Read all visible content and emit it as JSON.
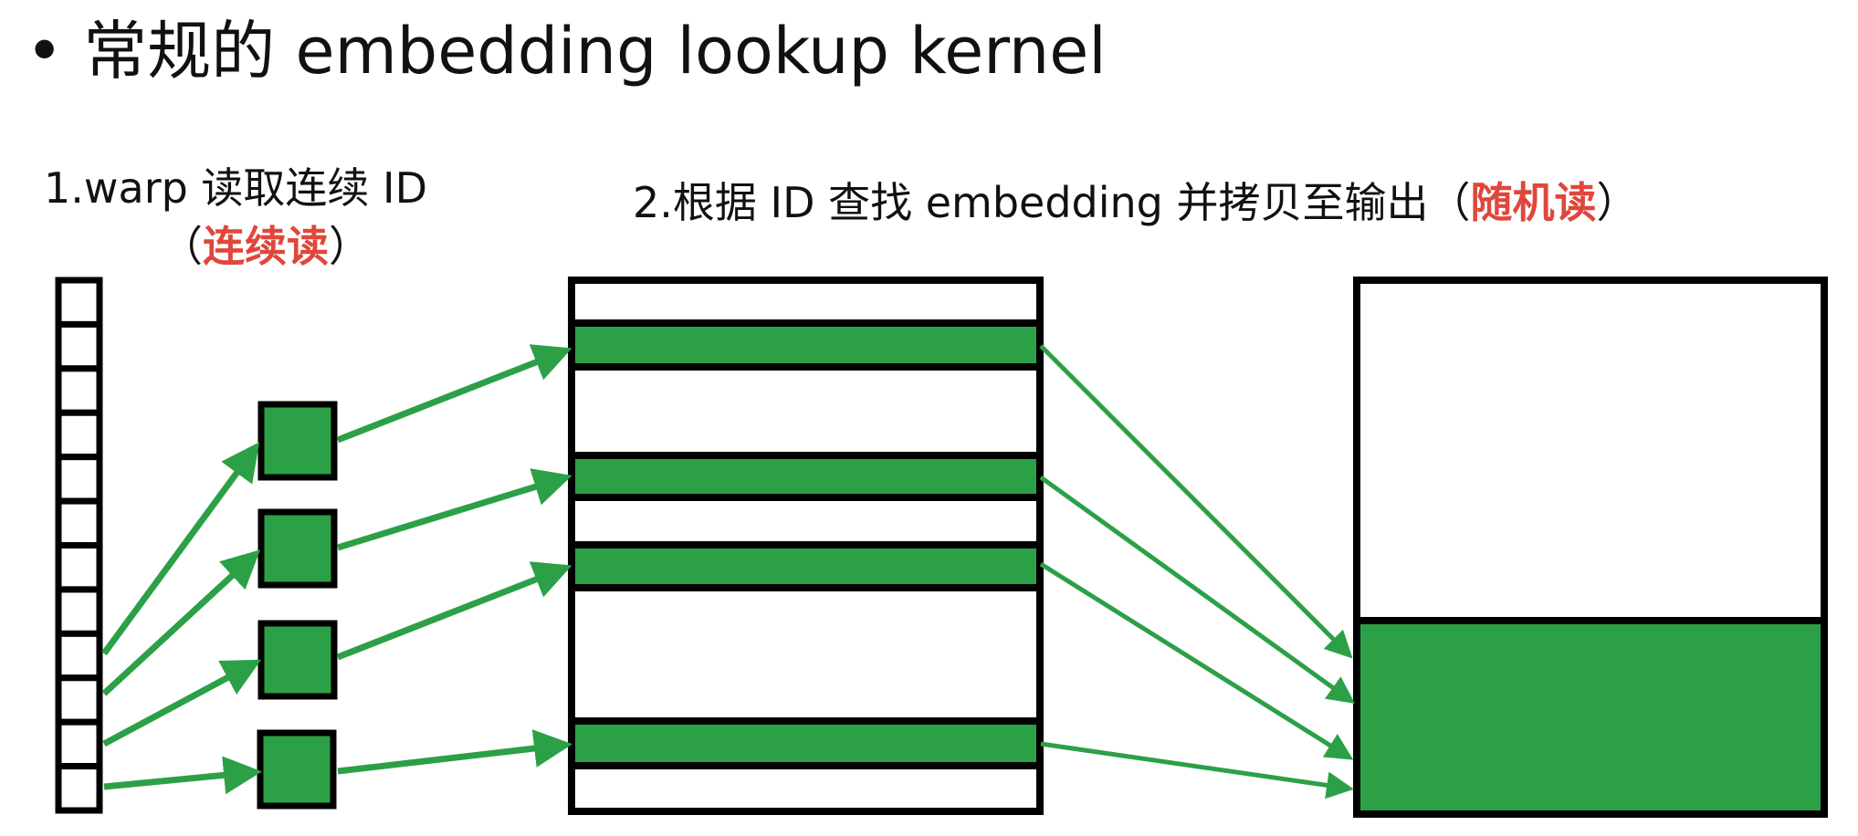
{
  "title": {
    "bullet": "•",
    "text": "常规的 embedding lookup kernel"
  },
  "step1": {
    "label": "1.warp 读取连续 ID",
    "paren_open": "（",
    "highlight": "连续读",
    "paren_close": "）"
  },
  "step2": {
    "label": "2.根据 ID 查找 embedding 并拷贝至输出",
    "paren_open": "（",
    "highlight": "随机读",
    "paren_close": "）"
  },
  "colors": {
    "green": "#2ca046",
    "red": "#e0473c",
    "border": "#000000"
  },
  "id_array_cells": 12
}
